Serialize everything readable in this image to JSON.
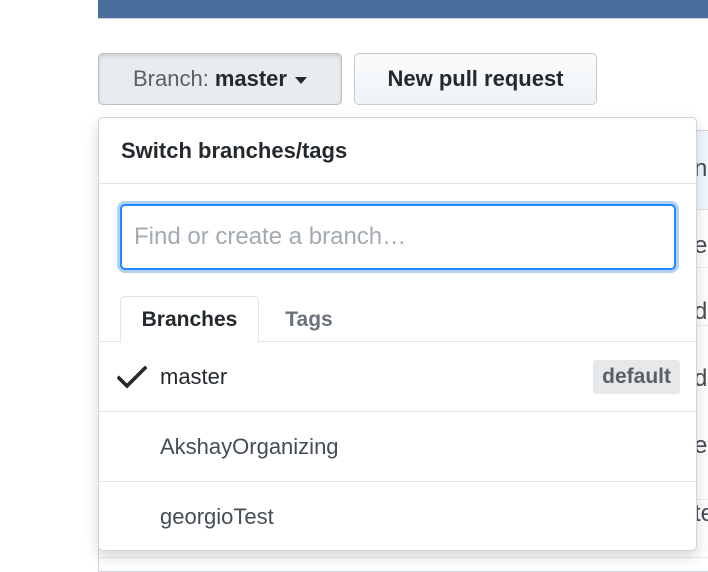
{
  "branch_button": {
    "prefix": "Branch:",
    "value": "master"
  },
  "new_pull_request_label": "New pull request",
  "dropdown": {
    "title": "Switch branches/tags",
    "filter_placeholder": "Find or create a branch…",
    "tabs": [
      {
        "label": "Branches",
        "active": true
      },
      {
        "label": "Tags",
        "active": false
      }
    ],
    "items": [
      {
        "label": "master",
        "selected": true,
        "badge": "default"
      },
      {
        "label": "AkshayOrganizing",
        "selected": false
      },
      {
        "label": "georgioTest",
        "selected": false
      }
    ]
  },
  "background_peek": [
    "n",
    "ea",
    "di",
    "di",
    "ea",
    "te"
  ],
  "colors": {
    "focus_border": "#2188ff",
    "header_bar": "#4a6f9c"
  }
}
